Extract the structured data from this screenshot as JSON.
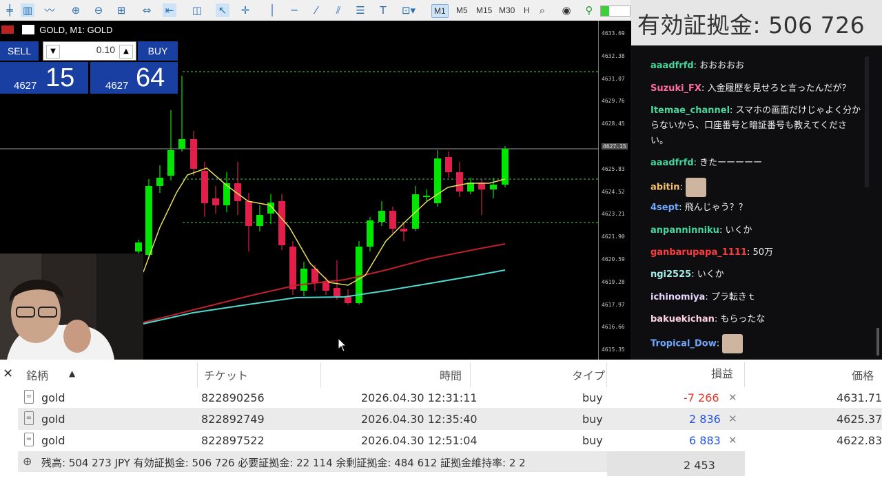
{
  "toolbar": {
    "icons": [
      "bar-chart-icon",
      "candles-icon",
      "line-chart-icon",
      "zoom-in-icon",
      "zoom-out-icon",
      "grid-icon",
      "autoscroll-icon",
      "chart-shift-icon",
      "screenshot-icon",
      "cursor-icon",
      "crosshair-icon",
      "vertical-line-icon",
      "horizontal-line-icon",
      "trendline-icon",
      "channel-icon",
      "fibo-icon",
      "text-icon",
      "shapes-icon"
    ],
    "timeframes": [
      "M1",
      "M5",
      "M15",
      "M30",
      "H"
    ],
    "active_timeframe": "M1"
  },
  "equity_banner": {
    "text": "有効証拠金: 506 726"
  },
  "chart": {
    "title": "GOLD, M1: GOLD",
    "price_labels": [
      "4633.69",
      "4632.38",
      "4631.07",
      "4629.76",
      "4628.45",
      "4627.15",
      "4625.83",
      "4624.52",
      "4623.21",
      "4621.90",
      "4620.59",
      "4619.28",
      "4617.97",
      "4616.66",
      "4615.35"
    ],
    "current_price": "4627.15",
    "bull_color": "#00e600",
    "bear_color": "#e0204a"
  },
  "one_click": {
    "sell_label": "SELL",
    "buy_label": "BUY",
    "volume": "0.10",
    "sell_prefix": "4627",
    "sell_big": "15",
    "buy_prefix": "4627",
    "buy_big": "64"
  },
  "chat": {
    "messages": [
      {
        "user": "aaadfrfd",
        "color": "#44d69c",
        "text": "おおおおお"
      },
      {
        "user": "Suzuki_FX",
        "color": "#ff6b9c",
        "text": "入金履歴を見せろと言ったんだが？"
      },
      {
        "user": "Itemae_channel",
        "color": "#44d69c",
        "text": "スマホの画面だけじゃよく分からないから、口座番号と暗証番号も教えてください。"
      },
      {
        "user": "aaadfrfd",
        "color": "#44d69c",
        "text": "きたーーーーー"
      },
      {
        "user": "abitin",
        "color": "#f5c36b",
        "text": ""
      },
      {
        "user": "4sept",
        "color": "#6fa7ff",
        "text": "飛んじゃう？？"
      },
      {
        "user": "anpanninniku",
        "color": "#44d69c",
        "text": "いくか"
      },
      {
        "user": "ganbarupapa_1111",
        "color": "#ff3c3c",
        "text": "50万"
      },
      {
        "user": "ngi2525",
        "color": "#a4f0e8",
        "text": "いくか"
      },
      {
        "user": "ichinomiya",
        "color": "#e8d8ff",
        "text": "プラ転きｔ"
      },
      {
        "user": "bakuekichan",
        "color": "#ffd2e0",
        "text": "もらったな"
      },
      {
        "user": "Tropical_Dow",
        "color": "#6fa7ff",
        "text": ""
      }
    ]
  },
  "trades": {
    "headers": [
      "銘柄",
      "チケット",
      "時間",
      "タイプ",
      "損益",
      "価格"
    ],
    "rows": [
      {
        "symbol": "gold",
        "ticket": "822890256",
        "time": "2026.04.30 12:31:11",
        "type": "buy",
        "profit": "-7 266",
        "price": "4631.71"
      },
      {
        "symbol": "gold",
        "ticket": "822892749",
        "time": "2026.04.30 12:35:40",
        "type": "buy",
        "profit": "2 836",
        "price": "4625.37"
      },
      {
        "symbol": "gold",
        "ticket": "822897522",
        "time": "2026.04.30 12:51:04",
        "type": "buy",
        "profit": "6 883",
        "price": "4622.83"
      }
    ],
    "summary": "残高: 504 273 JPY  有効証拠金: 506 726  必要証拠金: 22 114  余剰証拠金: 484 612  証拠金維持率: 2 2",
    "total_profit": "2 453",
    "profit_negative_color": "#e8342a",
    "profit_positive_color": "#2255dd"
  }
}
